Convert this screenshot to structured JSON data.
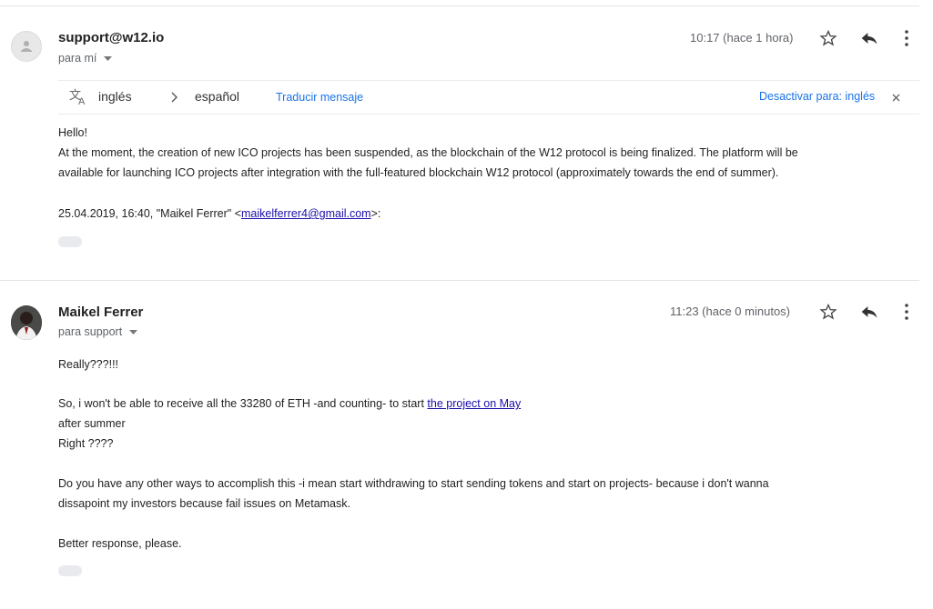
{
  "message1": {
    "sender": "support@w12.io",
    "recipient": "para mí",
    "time": "10:17 (hace 1 hora)",
    "translate": {
      "from_lang": "inglés",
      "to_lang": "español",
      "translate_link": "Traducir mensaje",
      "disable_link": "Desactivar para: inglés"
    },
    "body": {
      "greeting": "Hello!",
      "line1": "At the moment, the creation of new ICO projects has been suspended, as the blockchain of the W12 protocol is being finalized. The platform will be",
      "line2": "available for launching ICO projects after integration with the full-featured blockchain W12 protocol (approximately towards the end of summer).",
      "quote_prefix": "25.04.2019, 16:40, \"Maikel Ferrer\" <",
      "quote_email": "maikelferrer4@gmail.com",
      "quote_suffix": ">:"
    }
  },
  "message2": {
    "sender": "Maikel Ferrer",
    "recipient": "para support",
    "time": "11:23 (hace 0 minutos)",
    "body": {
      "line1": "Really???!!!",
      "line2_prefix": "So, i won't be able to receive all the 33280 of ETH -and counting- to start ",
      "line2_link": "the project on May ",
      "line3": "after summer",
      "line4": "Right ????",
      "line5": "Do you have any other ways to accomplish this -i mean start withdrawing to start sending tokens and start on projects- because i don't wanna",
      "line6": "dissapoint my investors because fail issues on Metamask.",
      "line7": "Better response, please."
    }
  },
  "icons": [
    "star-icon",
    "reply-icon",
    "more-vert-icon",
    "translate-icon",
    "chevron-right-icon",
    "dropdown-icon",
    "close-icon"
  ],
  "colors": {
    "link": "#1a0dab",
    "accent": "#1a73e8",
    "muted": "#5f6368"
  }
}
